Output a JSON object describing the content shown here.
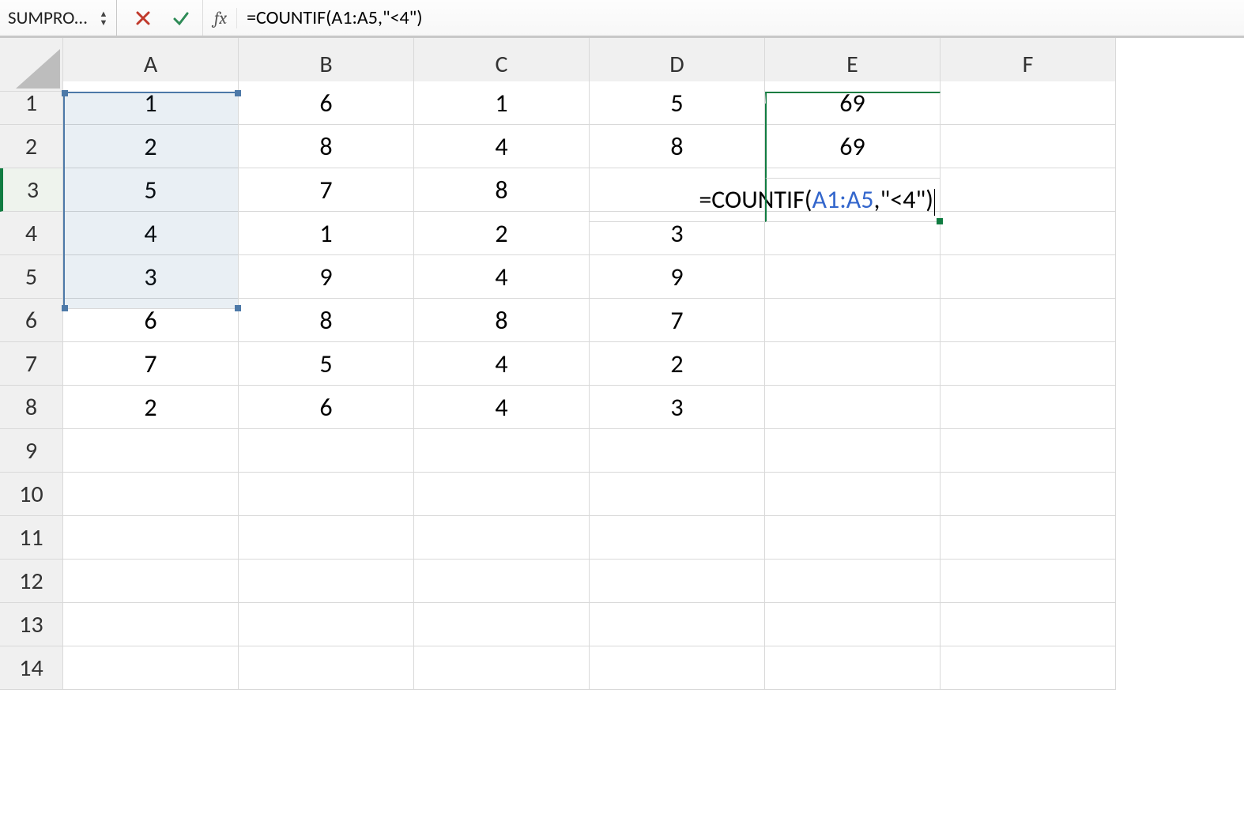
{
  "formula_bar": {
    "name_box": "SUMPRO…",
    "fx_label": "fx",
    "formula_prefix": "=COUNTIF(A1:A5,\"<4\")"
  },
  "columns": [
    "A",
    "B",
    "C",
    "D",
    "E",
    "F"
  ],
  "row_numbers": [
    "1",
    "2",
    "3",
    "4",
    "5",
    "6",
    "7",
    "8",
    "9",
    "10",
    "11",
    "12",
    "13",
    "14"
  ],
  "grid": {
    "A": [
      "1",
      "2",
      "5",
      "4",
      "3",
      "6",
      "7",
      "2",
      "",
      "",
      "",
      "",
      "",
      ""
    ],
    "B": [
      "6",
      "8",
      "7",
      "1",
      "9",
      "8",
      "5",
      "6",
      "",
      "",
      "",
      "",
      "",
      ""
    ],
    "C": [
      "1",
      "4",
      "8",
      "2",
      "4",
      "8",
      "4",
      "4",
      "",
      "",
      "",
      "",
      "",
      ""
    ],
    "D": [
      "5",
      "8",
      "",
      "3",
      "9",
      "7",
      "2",
      "3",
      "",
      "",
      "",
      "",
      "",
      ""
    ],
    "E": [
      "69",
      "69",
      "",
      "",
      "",
      "",
      "",
      "",
      "",
      "",
      "",
      "",
      "",
      ""
    ],
    "F": [
      "",
      "",
      "",
      "",
      "",
      "",
      "",
      "",
      "",
      "",
      "",
      "",
      "",
      ""
    ]
  },
  "editing": {
    "formula_plain_prefix": "=COUNTIF(",
    "formula_ref": "A1:A5",
    "formula_plain_suffix": ",\"<4\")"
  },
  "chart_data": {
    "type": "table",
    "active_cell": "E3",
    "selection_range": "A1:A5",
    "formula": "=COUNTIF(A1:A5,\"<4\")",
    "columns": [
      "A",
      "B",
      "C",
      "D",
      "E"
    ],
    "rows": [
      {
        "A": 1,
        "B": 6,
        "C": 1,
        "D": 5,
        "E": 69
      },
      {
        "A": 2,
        "B": 8,
        "C": 4,
        "D": 8,
        "E": 69
      },
      {
        "A": 5,
        "B": 7,
        "C": 8,
        "D": null,
        "E": "=COUNTIF(A1:A5,\"<4\")"
      },
      {
        "A": 4,
        "B": 1,
        "C": 2,
        "D": 3,
        "E": null
      },
      {
        "A": 3,
        "B": 9,
        "C": 4,
        "D": 9,
        "E": null
      },
      {
        "A": 6,
        "B": 8,
        "C": 8,
        "D": 7,
        "E": null
      },
      {
        "A": 7,
        "B": 5,
        "C": 4,
        "D": 2,
        "E": null
      },
      {
        "A": 2,
        "B": 6,
        "C": 4,
        "D": 3,
        "E": null
      }
    ]
  }
}
